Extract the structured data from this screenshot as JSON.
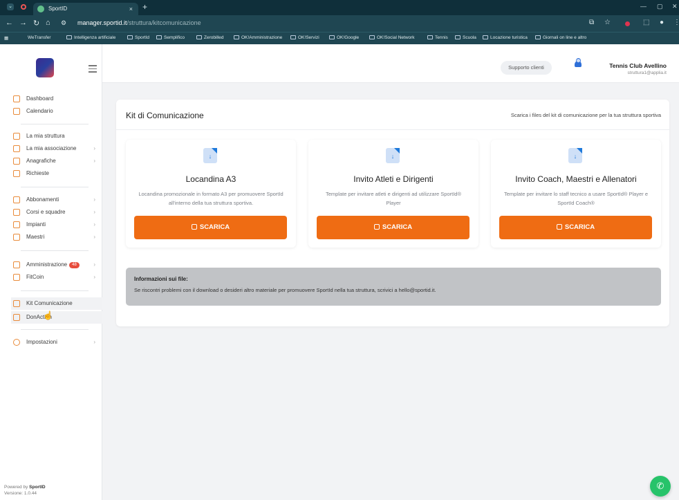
{
  "browser": {
    "tab_title": "SportID",
    "tab_close": "×",
    "new_tab": "+",
    "url_domain": "manager.sportid.it",
    "url_path": "/struttura/kitcomunicazione",
    "bookmarks": [
      "WeTransfer",
      "Intelligenza artificiale",
      "SportId",
      "Semplifico",
      "Zerobilled",
      "OK!Amministrazione",
      "OK!Servizi",
      "OK!Google",
      "OK!Social Network",
      "Tennis",
      "Scuola",
      "Locazione turistica",
      "Giornali on line e altro"
    ]
  },
  "header": {
    "support_label": "Supporto clienti",
    "notification_count": "0",
    "user_name": "Tennis Club Avellino",
    "user_email": "struttura1@applia.it"
  },
  "sidebar": {
    "items": [
      {
        "label": "Dashboard"
      },
      {
        "label": "Calendario"
      },
      {
        "label": "La mia struttura"
      },
      {
        "label": "La mia associazione",
        "arrow": "›"
      },
      {
        "label": "Anagrafiche",
        "arrow": "›"
      },
      {
        "label": "Richieste"
      },
      {
        "label": "Abbonamenti",
        "arrow": "›"
      },
      {
        "label": "Corsi e squadre",
        "arrow": "›"
      },
      {
        "label": "Impianti",
        "arrow": "›"
      },
      {
        "label": "Maestri",
        "arrow": "›"
      },
      {
        "label": "Amministrazione",
        "badge": "48",
        "arrow": "›"
      },
      {
        "label": "FitCoin",
        "arrow": "›"
      },
      {
        "label": "Kit Comunicazione"
      },
      {
        "label": "DonAction"
      },
      {
        "label": "Impostazioni",
        "arrow": "›"
      }
    ],
    "powered_by": "Powered by",
    "powered_brand": "SportID",
    "version": "Versione: 1.0.44"
  },
  "main": {
    "title": "Kit di Comunicazione",
    "subtitle": "Scarica i files del kit di comunicazione per la tua struttura sportiva",
    "kits": [
      {
        "title": "Locandina A3",
        "description": "Locandina promozionale in formato A3 per promuovere SportId all'interno della tua struttura sportiva.",
        "button": "SCARICA"
      },
      {
        "title": "Invito Atleti e Dirigenti",
        "description": "Template per invitare atleti e dirigenti ad utilizzare SportId® Player",
        "button": "SCARICA"
      },
      {
        "title": "Invito Coach, Maestri e Allenatori",
        "description": "Template per invitare lo staff tecnico a usare SportId® Player e SportId Coach®",
        "button": "SCARICA"
      }
    ],
    "info_title": "Informazioni sui file:",
    "info_text": "Se riscontri problemi con il download o desideri altro materiale per promuovere SportId nella tua struttura, scrivici a hello@sportid.it."
  },
  "colors": {
    "accent": "#ef6c13",
    "chrome": "#1f4652",
    "chat": "#27c36a"
  }
}
